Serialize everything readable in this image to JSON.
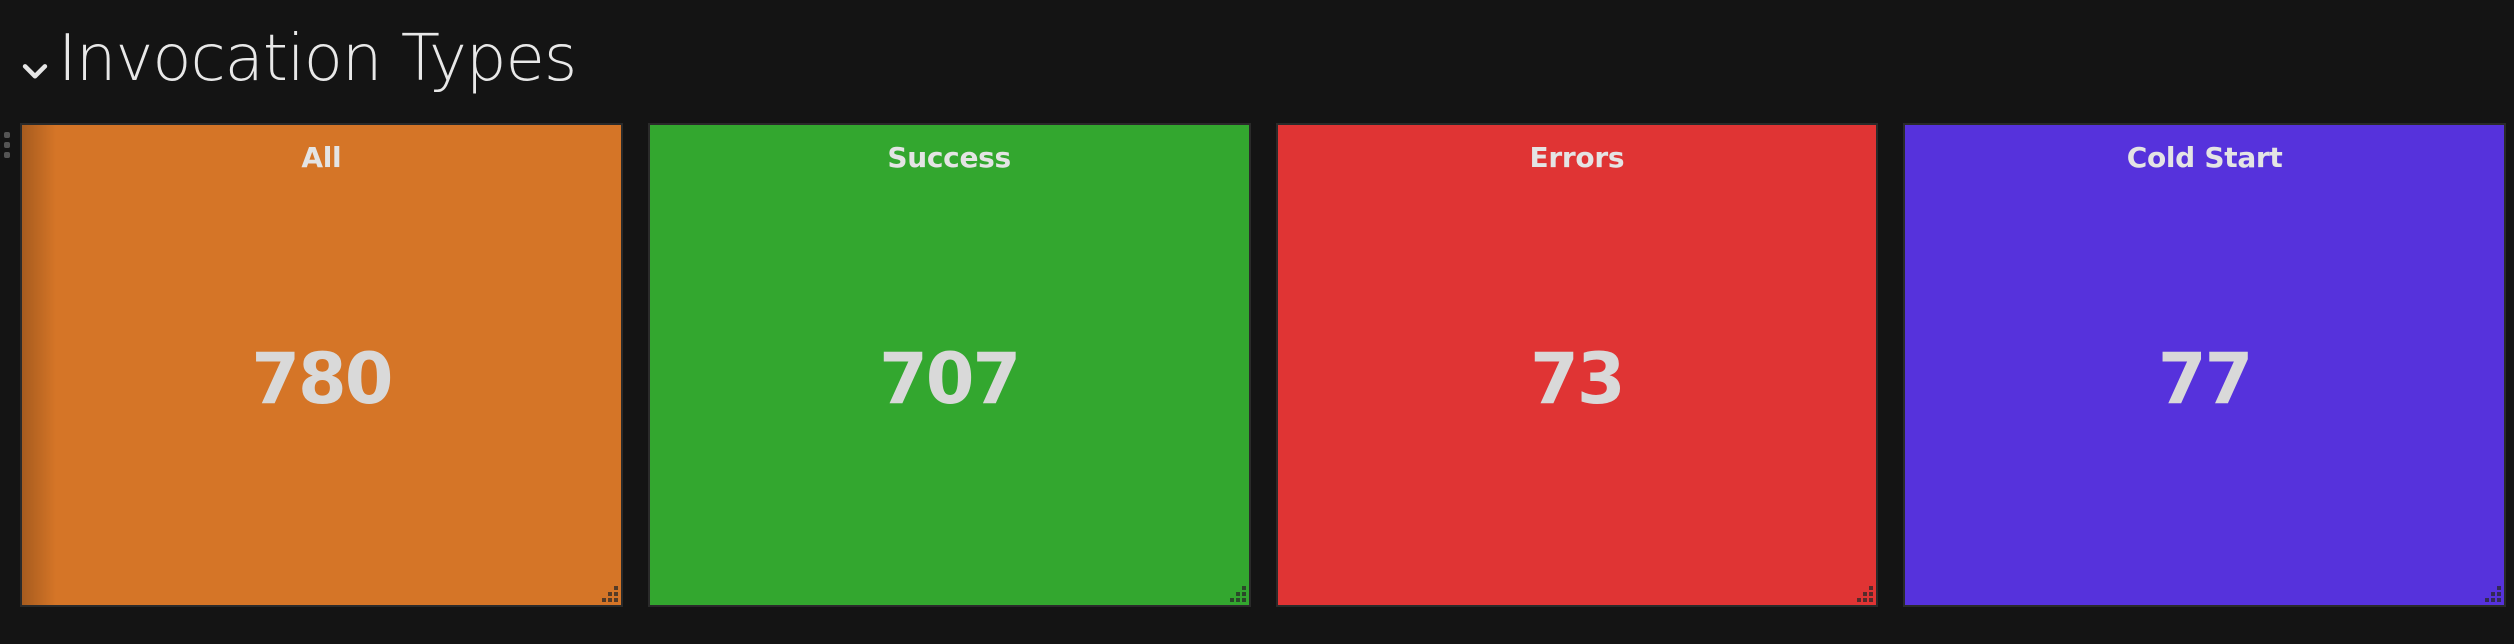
{
  "row": {
    "title": "Invocation Types",
    "toggle_icon": "chevron-down-icon"
  },
  "panels": [
    {
      "title": "All",
      "value": "780",
      "color": "#d57527"
    },
    {
      "title": "Success",
      "value": "707",
      "color": "#33a72f"
    },
    {
      "title": "Errors",
      "value": "73",
      "color": "#e03434"
    },
    {
      "title": "Cold Start",
      "value": "77",
      "color": "#5632dc"
    }
  ]
}
